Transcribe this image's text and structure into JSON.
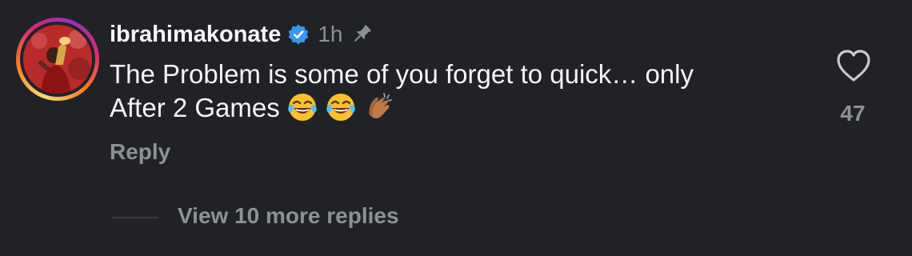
{
  "comment": {
    "username": "ibrahimakonate",
    "verified": true,
    "timestamp": "1h",
    "pinned": true,
    "text_line1": "The Problem is some of you forget to quick… only",
    "text_line2": "After 2 Games",
    "emojis": [
      "face-with-tears-of-joy",
      "face-with-tears-of-joy",
      "clapping-hands-medium-dark"
    ],
    "reply_label": "Reply",
    "like_count": "47",
    "view_more_label": "View 10 more replies"
  },
  "colors": {
    "background": "#212226",
    "text_primary": "#f3f4f6",
    "text_secondary": "#8e9097",
    "verified_blue": "#3897f0"
  }
}
